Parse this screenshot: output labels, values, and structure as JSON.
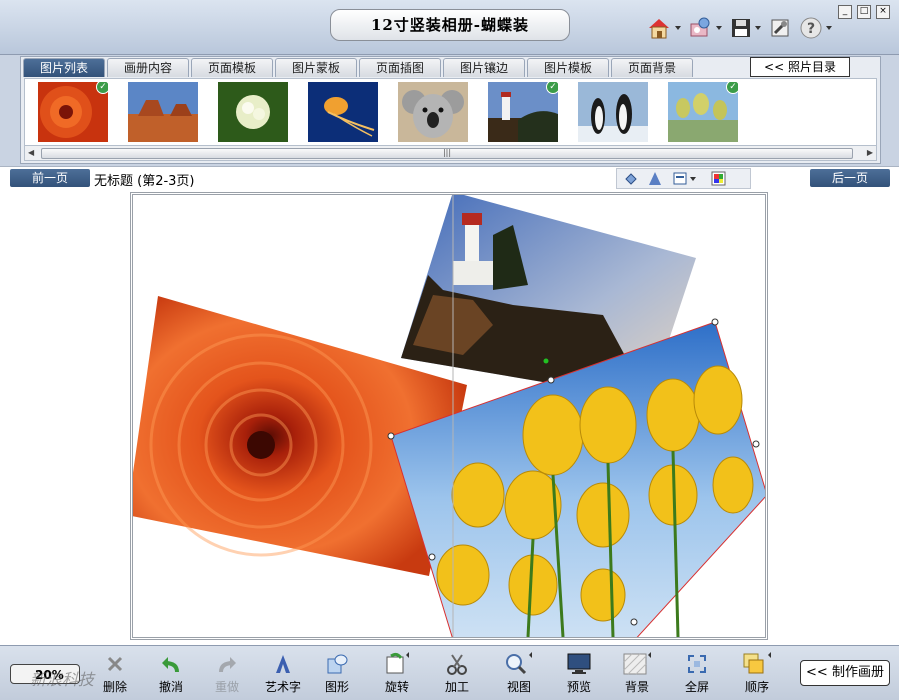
{
  "window": {
    "title": "12寸竖装相册-蝴蝶装",
    "buttons": {
      "minimize": "_",
      "maximize": "□",
      "close": "×"
    }
  },
  "toolbar_top": {
    "icons": [
      "home-icon",
      "photo-tool-icon",
      "save-icon",
      "tools-icon",
      "help-icon"
    ]
  },
  "tabs": [
    {
      "label": "图片列表",
      "active": true
    },
    {
      "label": "画册内容",
      "active": false
    },
    {
      "label": "页面模板",
      "active": false
    },
    {
      "label": "图片蒙板",
      "active": false
    },
    {
      "label": "页面插图",
      "active": false
    },
    {
      "label": "图片镶边",
      "active": false
    },
    {
      "label": "图片模板",
      "active": false
    },
    {
      "label": "页面背景",
      "active": false
    }
  ],
  "photo_dir_button": "<< 照片目录",
  "thumbnails": [
    {
      "subject": "chrysanthemum",
      "used": true
    },
    {
      "subject": "desert",
      "used": false
    },
    {
      "subject": "hydrangea",
      "used": false
    },
    {
      "subject": "jellyfish",
      "used": false
    },
    {
      "subject": "koala",
      "used": false
    },
    {
      "subject": "lighthouse",
      "used": true
    },
    {
      "subject": "penguins",
      "used": false
    },
    {
      "subject": "tulips",
      "used": true
    }
  ],
  "nav": {
    "prev": "前一页",
    "next": "后一页",
    "page_title": "无标题 (第2-3页)"
  },
  "zoom": "20%",
  "bottom_tools": [
    {
      "label": "删除",
      "icon": "delete-icon",
      "enabled": true
    },
    {
      "label": "撤消",
      "icon": "undo-icon",
      "enabled": true
    },
    {
      "label": "重做",
      "icon": "redo-icon",
      "enabled": false
    },
    {
      "label": "艺术字",
      "icon": "art-text-icon",
      "enabled": true
    },
    {
      "label": "图形",
      "icon": "shape-icon",
      "enabled": true
    },
    {
      "label": "旋转",
      "icon": "rotate-icon",
      "enabled": true
    },
    {
      "label": "加工",
      "icon": "scissors-icon",
      "enabled": true
    },
    {
      "label": "视图",
      "icon": "zoom-view-icon",
      "enabled": true
    },
    {
      "label": "预览",
      "icon": "monitor-icon",
      "enabled": true
    },
    {
      "label": "背景",
      "icon": "background-icon",
      "enabled": true
    },
    {
      "label": "全屏",
      "icon": "fullscreen-icon",
      "enabled": true
    },
    {
      "label": "顺序",
      "icon": "order-icon",
      "enabled": true
    }
  ],
  "make_album_button": "<< 制作画册",
  "watermark": "新浪科技",
  "colors": {
    "tab_active": "#3f6189",
    "selection_border": "#e03030"
  }
}
